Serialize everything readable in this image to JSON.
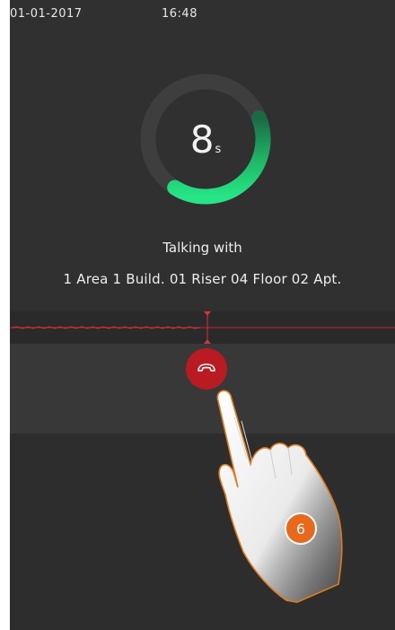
{
  "status_bar": {
    "date": "01-01-2017",
    "time": "16:48"
  },
  "timer": {
    "value": "8",
    "unit": "s",
    "progress": 0.4,
    "track_color": "#3e3e3e",
    "progress_color": "#1fd97a"
  },
  "call": {
    "label": "Talking with",
    "address": "1 Area 1 Build. 01 Riser 04 Floor 02 Apt."
  },
  "controls": {
    "hangup_icon": "phone-hangup-icon",
    "hangup_color": "#b81c22"
  },
  "annotation": {
    "step_number": "6",
    "badge_color": "#e8681c"
  }
}
